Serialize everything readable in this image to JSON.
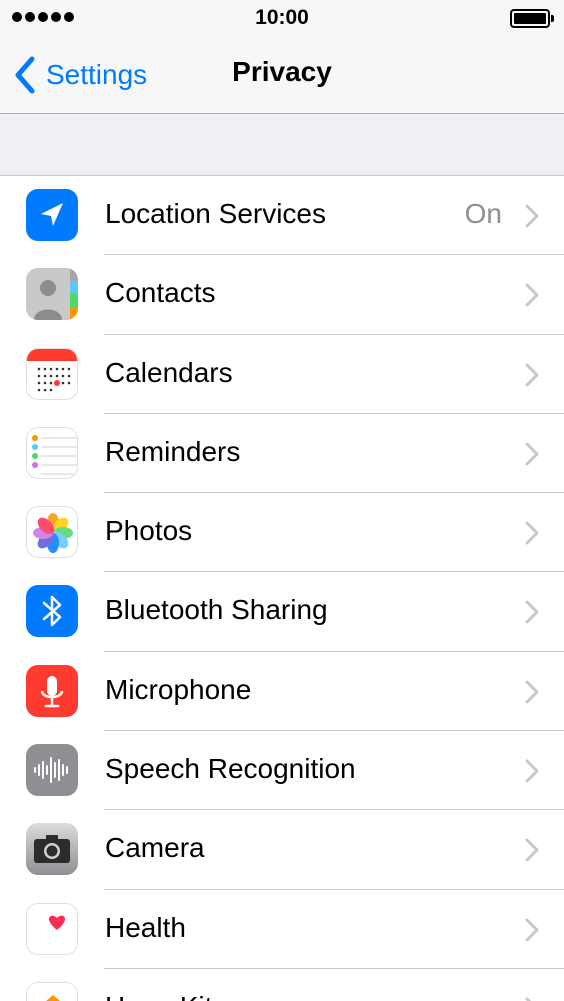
{
  "status_bar": {
    "time": "10:00",
    "signal_bars": 5,
    "battery_level": 1.0
  },
  "nav": {
    "back_label": "Settings",
    "title": "Privacy"
  },
  "colors": {
    "accent": "#007aff",
    "background": "#efeff4",
    "secondary_text": "#8e8e93"
  },
  "rows": [
    {
      "label": "Location Services",
      "value": "On",
      "icon": "location-arrow-icon"
    },
    {
      "label": "Contacts",
      "value": "",
      "icon": "contacts-icon"
    },
    {
      "label": "Calendars",
      "value": "",
      "icon": "calendar-icon"
    },
    {
      "label": "Reminders",
      "value": "",
      "icon": "reminders-icon"
    },
    {
      "label": "Photos",
      "value": "",
      "icon": "photos-icon"
    },
    {
      "label": "Bluetooth Sharing",
      "value": "",
      "icon": "bluetooth-icon"
    },
    {
      "label": "Microphone",
      "value": "",
      "icon": "microphone-icon"
    },
    {
      "label": "Speech Recognition",
      "value": "",
      "icon": "speech-waveform-icon"
    },
    {
      "label": "Camera",
      "value": "",
      "icon": "camera-icon"
    },
    {
      "label": "Health",
      "value": "",
      "icon": "health-heart-icon"
    },
    {
      "label": "HomeKit",
      "value": "",
      "icon": "homekit-icon"
    }
  ]
}
